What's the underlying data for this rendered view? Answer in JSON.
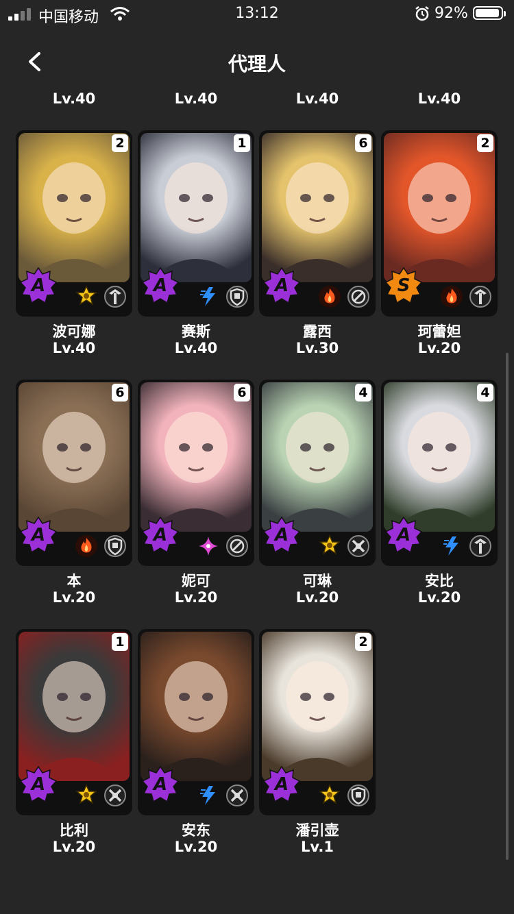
{
  "status": {
    "carrier": "中国移动",
    "time": "13:12",
    "battery": "92%"
  },
  "nav": {
    "title": "代理人"
  },
  "top_levels": [
    "Lv.40",
    "Lv.40",
    "Lv.40",
    "Lv.40"
  ],
  "agents": [
    {
      "name": "波可娜",
      "level": "Lv.40",
      "rank": "2",
      "grade": "A",
      "attribute": "physical",
      "specialty": "stun"
    },
    {
      "name": "赛斯",
      "level": "Lv.40",
      "rank": "1",
      "grade": "A",
      "attribute": "electric",
      "specialty": "defense"
    },
    {
      "name": "露西",
      "level": "Lv.30",
      "rank": "6",
      "grade": "A",
      "attribute": "fire",
      "specialty": "support"
    },
    {
      "name": "珂蕾妲",
      "level": "Lv.20",
      "rank": "2",
      "grade": "S",
      "attribute": "fire",
      "specialty": "stun"
    },
    {
      "name": "本",
      "level": "Lv.20",
      "rank": "6",
      "grade": "A",
      "attribute": "fire",
      "specialty": "defense"
    },
    {
      "name": "妮可",
      "level": "Lv.20",
      "rank": "6",
      "grade": "A",
      "attribute": "ether",
      "specialty": "support"
    },
    {
      "name": "可琳",
      "level": "Lv.20",
      "rank": "4",
      "grade": "A",
      "attribute": "physical",
      "specialty": "attack"
    },
    {
      "name": "安比",
      "level": "Lv.20",
      "rank": "4",
      "grade": "A",
      "attribute": "electric",
      "specialty": "stun"
    },
    {
      "name": "比利",
      "level": "Lv.20",
      "rank": "1",
      "grade": "A",
      "attribute": "physical",
      "specialty": "attack"
    },
    {
      "name": "安东",
      "level": "Lv.20",
      "rank": "",
      "grade": "A",
      "attribute": "electric",
      "specialty": "attack"
    },
    {
      "name": "潘引壶",
      "level": "Lv.1",
      "rank": "2",
      "grade": "A",
      "attribute": "physical",
      "specialty": "defense"
    }
  ],
  "colors": {
    "background": "#262626",
    "grade_a": "#9b30d9",
    "grade_s": "#f28a12",
    "fire": "#ff5a1e",
    "electric": "#2f8fff",
    "physical": "#f5c518",
    "ether": "#e04bd6"
  }
}
